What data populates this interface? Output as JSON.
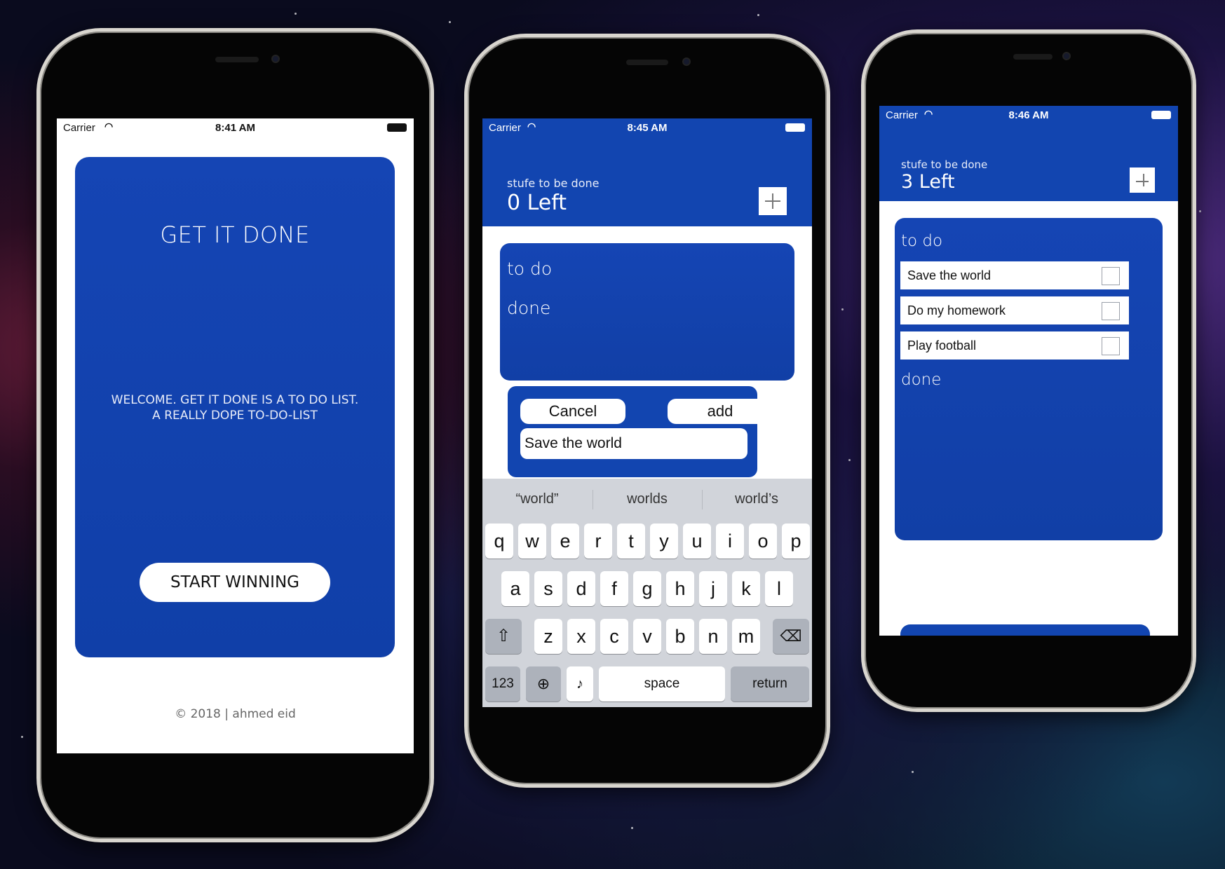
{
  "colors": {
    "brand_blue": "#1245b0",
    "white": "#ffffff"
  },
  "screen1": {
    "status": {
      "carrier": "Carrier",
      "time": "8:41 AM"
    },
    "title": "GET IT DONE",
    "welcome_line1": "WELCOME. GET IT DONE IS A TO DO LIST.",
    "welcome_line2": "A REALLY DOPE TO-DO-LIST",
    "start_button": "START WINNING",
    "copyright": "© 2018 | ahmed eid"
  },
  "screen2": {
    "status": {
      "carrier": "Carrier",
      "time": "8:45 AM"
    },
    "header_subtitle": "stufe to be done",
    "header_count": "0 Left",
    "sections": {
      "todo": "to do",
      "done": "done"
    },
    "cancel_button": "Cancel",
    "add_button": "add",
    "input_value": "Save the world",
    "suggestions": [
      "“world”",
      "worlds",
      "world’s"
    ],
    "keyboard": {
      "row1": [
        "q",
        "w",
        "e",
        "r",
        "t",
        "y",
        "u",
        "i",
        "o",
        "p"
      ],
      "row2": [
        "a",
        "s",
        "d",
        "f",
        "g",
        "h",
        "j",
        "k",
        "l"
      ],
      "row3": [
        "z",
        "x",
        "c",
        "v",
        "b",
        "n",
        "m"
      ],
      "numbers_key": "123",
      "space_key": "space",
      "return_key": "return"
    }
  },
  "screen3": {
    "status": {
      "carrier": "Carrier",
      "time": "8:46 AM"
    },
    "header_subtitle": "stufe to be done",
    "header_count": "3 Left",
    "sections": {
      "todo": "to do",
      "done": "done"
    },
    "tasks": [
      {
        "label": "Save the world",
        "checked": false
      },
      {
        "label": "Do my homework",
        "checked": false
      },
      {
        "label": "Play football",
        "checked": false
      }
    ]
  }
}
